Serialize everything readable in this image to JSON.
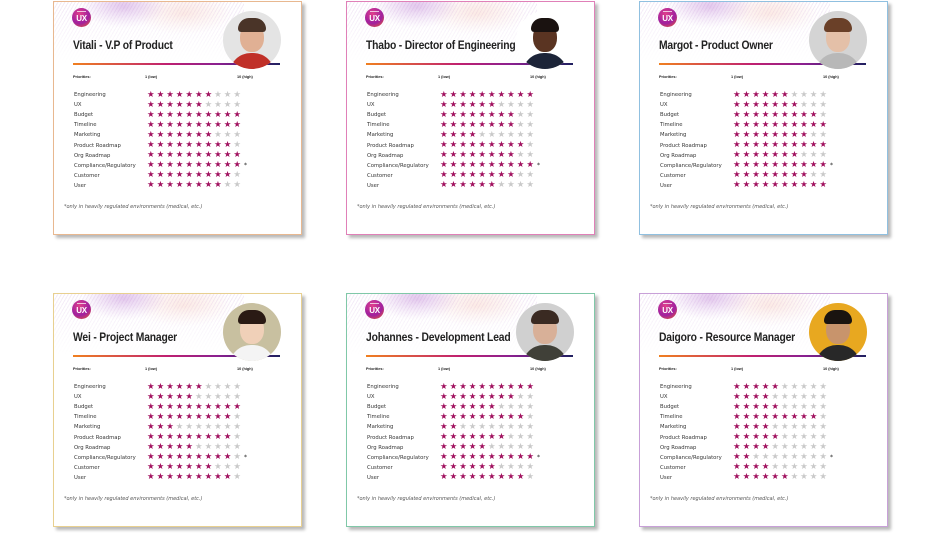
{
  "labels": {
    "priorities": "Priorities:",
    "low": "1 (low)",
    "high": "10 (high)",
    "footnote": "*only in heavily regulated environments (medical, etc.)",
    "asterisk": "*",
    "logo": "UX",
    "star_glyph": "★"
  },
  "max_rating": 10,
  "categories": [
    "Engineering",
    "UX",
    "Budget",
    "Timeline",
    "Marketing",
    "Product Roadmap",
    "Org Roadmap",
    "Compliance/Regulatory",
    "Customer",
    "User"
  ],
  "asterisk_category_index": 7,
  "colors": {
    "star_on": "#a0105e",
    "star_off": "#c9c9c9",
    "rule_start": "#f08020",
    "rule_end": "#202060"
  },
  "cards": [
    {
      "name": "Vitali - V.P of Product",
      "border": "#e8b890",
      "avatar": {
        "bg": "#e4e4e4",
        "skin": "#e0b094",
        "hair": "#4a3428",
        "shirt": "#c03028"
      },
      "ratings": [
        7,
        6,
        10,
        10,
        7,
        9,
        10,
        10,
        9,
        8
      ]
    },
    {
      "name": "Thabo - Director of Engineering",
      "border": "#e080b8",
      "avatar": {
        "bg": "#ffffff",
        "skin": "#5a3422",
        "hair": "#1a1210",
        "shirt": "#1c2438"
      },
      "ratings": [
        10,
        6,
        8,
        8,
        4,
        9,
        8,
        10,
        8,
        6
      ]
    },
    {
      "name": "Margot - Product Owner",
      "border": "#90c0e0",
      "avatar": {
        "bg": "#d4d4d4",
        "skin": "#e4c0a8",
        "hair": "#6a4028",
        "shirt": "#b8b8b8"
      },
      "ratings": [
        6,
        7,
        9,
        10,
        8,
        10,
        7,
        10,
        8,
        10
      ]
    },
    {
      "name": "Wei - Project Manager",
      "border": "#e8d090",
      "avatar": {
        "bg": "#c8c0a0",
        "skin": "#f0d0b8",
        "hair": "#2a1a14",
        "shirt": "#f4f4f4"
      },
      "ratings": [
        6,
        5,
        10,
        9,
        3,
        9,
        5,
        9,
        7,
        9
      ]
    },
    {
      "name": "Johannes - Development Lead",
      "border": "#80c8a8",
      "avatar": {
        "bg": "#d0d0d0",
        "skin": "#d8b098",
        "hair": "#3a2a22",
        "shirt": "#404038"
      },
      "ratings": [
        10,
        8,
        6,
        9,
        2,
        7,
        5,
        10,
        6,
        9
      ]
    },
    {
      "name": "Daigoro - Resource Manager",
      "border": "#c8a0d8",
      "avatar": {
        "bg": "#e8a820",
        "skin": "#c8946c",
        "hair": "#1a1410",
        "shirt": "#282828"
      },
      "ratings": [
        5,
        4,
        5,
        9,
        4,
        5,
        4,
        2,
        4,
        6
      ]
    }
  ]
}
